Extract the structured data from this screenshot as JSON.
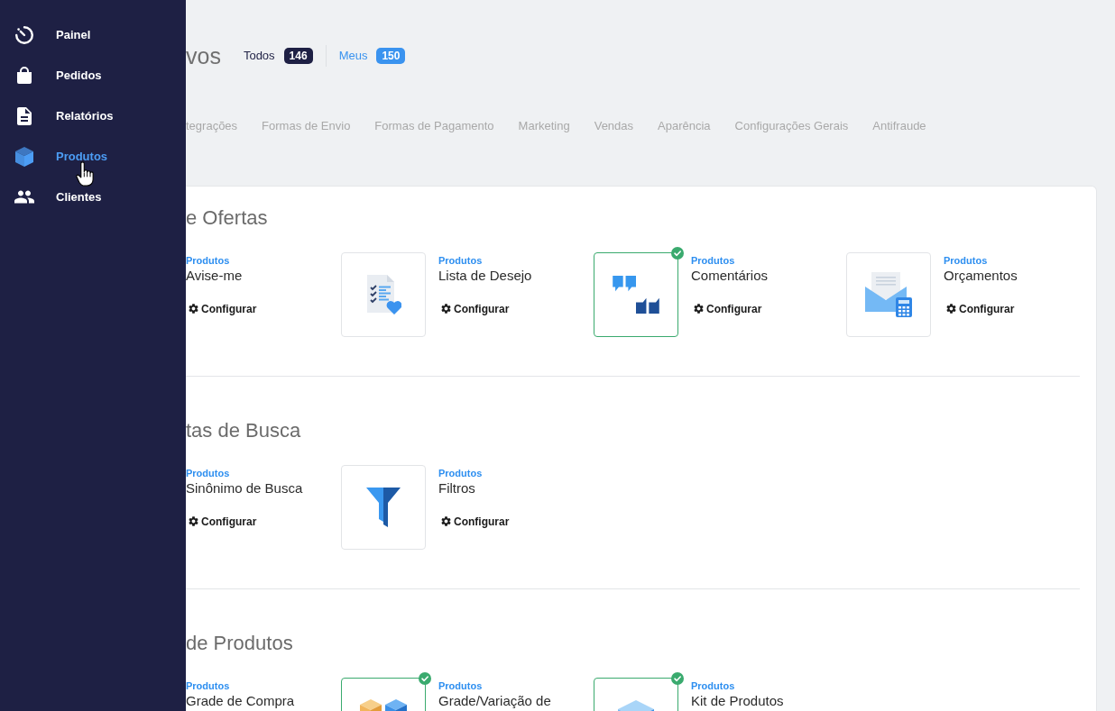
{
  "sidebar": {
    "items": [
      {
        "label": "Painel",
        "selected": false
      },
      {
        "label": "Pedidos",
        "selected": false
      },
      {
        "label": "Relatórios",
        "selected": false
      },
      {
        "label": "Produtos",
        "selected": true
      },
      {
        "label": "Clientes",
        "selected": false
      }
    ]
  },
  "header": {
    "title": "vos",
    "filters": [
      {
        "label": "Todos",
        "count": "146",
        "selected": true
      },
      {
        "label": "Meus",
        "count": "150",
        "selected": false
      }
    ]
  },
  "tabs": [
    {
      "label": "tegrações",
      "selected": false
    },
    {
      "label": "Formas de Envio",
      "selected": false
    },
    {
      "label": "Formas de Pagamento",
      "selected": false
    },
    {
      "label": "Marketing",
      "selected": false
    },
    {
      "label": "Vendas",
      "selected": false
    },
    {
      "label": "Aparência",
      "selected": false
    },
    {
      "label": "Configurações Gerais",
      "selected": false
    },
    {
      "label": "Antifraude",
      "selected": false
    }
  ],
  "sections": [
    {
      "title": "e Ofertas",
      "apps": [
        {
          "category": "Produtos",
          "name": "Avise-me",
          "action": "Configurar"
        },
        {
          "category": "Produtos",
          "name": "Lista de Desejo",
          "action": "Configurar",
          "installed": false
        },
        {
          "category": "Produtos",
          "name": "Comentários",
          "action": "Configurar",
          "installed": true
        },
        {
          "category": "Produtos",
          "name": "Orçamentos",
          "action": "Configurar",
          "installed": false
        }
      ]
    },
    {
      "title": "tas de Busca",
      "apps": [
        {
          "category": "Produtos",
          "name": "Sinônimo de Busca",
          "action": "Configurar"
        },
        {
          "category": "Produtos",
          "name": "Filtros",
          "action": "Configurar",
          "installed": false
        }
      ]
    },
    {
      "title": "de Produtos",
      "apps": [
        {
          "category": "Produtos",
          "name": "Grade de Compra"
        },
        {
          "category": "Produtos",
          "name": "Grade/Variação de",
          "installed": true
        },
        {
          "category": "Produtos",
          "name": "Kit de Produtos",
          "installed": true
        }
      ]
    }
  ]
}
